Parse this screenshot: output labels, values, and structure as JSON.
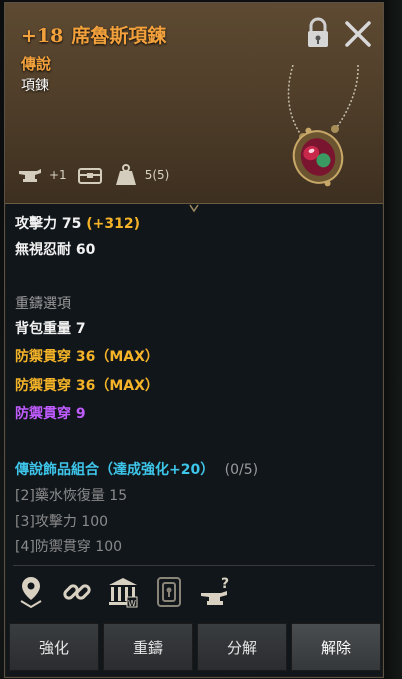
{
  "header": {
    "enhance_level": "+18",
    "item_name": "席魯斯項鍊",
    "grade": "傳說",
    "item_type": "項鍊",
    "icons": [
      "anvil-icon",
      "chest-icon",
      "weight-icon"
    ],
    "anvil_badge": "+1",
    "weight_count": "5(5)"
  },
  "stats": {
    "attack": "攻擊力 75",
    "attack_bonus": "(+312)",
    "ignore_resist": "無視忍耐 60",
    "recast_header": "重鑄選項",
    "recast_1": "背包重量 7",
    "recast_2": "防禦貫穿 36（MAX）",
    "recast_3": "防禦貫穿 36（MAX）",
    "recast_4": "防禦貫穿 9",
    "set_title": "傳說飾品組合（達成強化+20）",
    "set_progress": "(0/5)",
    "set_1": "[2]藥水恢復量 15",
    "set_2": "[3]攻擊力 100",
    "set_3": "[4]防禦貫穿 100"
  },
  "tools": [
    "location-icon",
    "link-icon",
    "bank-icon",
    "lock-slot-icon",
    "anvil-question-icon"
  ],
  "buttons": {
    "enhance": "強化",
    "recast": "重鑄",
    "dismantle": "分解",
    "release": "解除"
  },
  "colors": {
    "gold": "#f5b428",
    "orange_title": "#f2a13c",
    "purple": "#c05cff",
    "cyan": "#3ec6ea"
  }
}
